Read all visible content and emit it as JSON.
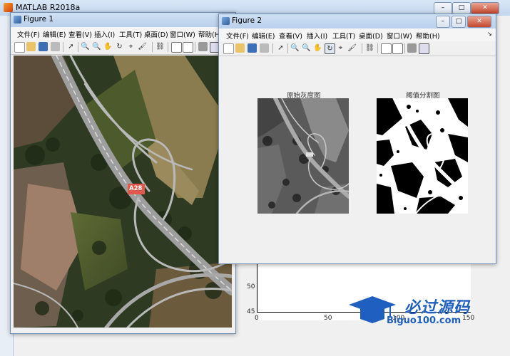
{
  "matlab": {
    "title": "MATLAB R2018a"
  },
  "figure1": {
    "title": "Figure 1",
    "menu": [
      "文件(F)",
      "编辑(E)",
      "查看(V)",
      "插入(I)",
      "工具(T)",
      "桌面(D)",
      "窗口(W)",
      "帮助(H)"
    ],
    "road_sign": "A28"
  },
  "figure2": {
    "title": "Figure 2",
    "menu": [
      "文件(F)",
      "编辑(E)",
      "查看(V)",
      "插入(I)",
      "工具(T)",
      "桌面(D)",
      "窗口(W)",
      "帮助(H)"
    ],
    "panel_left_title": "原始灰度图",
    "panel_right_title": "阈值分割图"
  },
  "bgplot": {
    "y_ticks": [
      "50",
      "45"
    ],
    "x_ticks": [
      "0",
      "50",
      "100",
      "150"
    ]
  },
  "watermark": {
    "cn": "必过源码",
    "en": "Biguo100.com"
  },
  "colors": {
    "accent": "#1f5fbf",
    "titlebar": "#c3d6ee"
  }
}
